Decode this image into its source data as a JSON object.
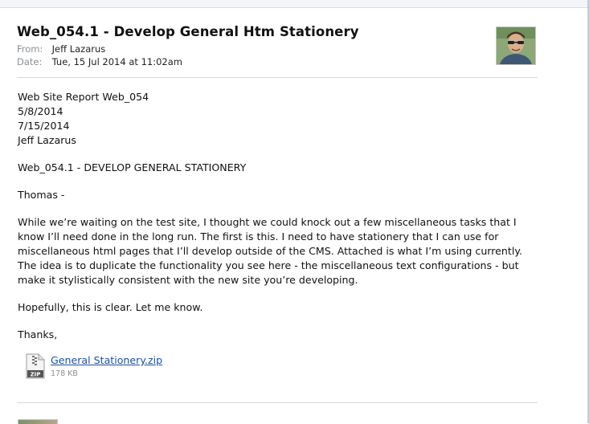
{
  "message": {
    "subject": "Web_054.1 - Develop General Htm Stationery",
    "from_label": "From:",
    "from_value": "Jeff Lazarus",
    "date_label": "Date:",
    "date_value": "Tue, 15 Jul 2014 at 11:02am"
  },
  "body": {
    "report_lines": [
      "Web Site Report Web_054",
      "5/8/2014",
      "7/15/2014",
      "Jeff Lazarus"
    ],
    "heading": "Web_054.1 - DEVELOP GENERAL STATIONERY",
    "salutation": "Thomas -",
    "paragraph_lines": [
      "While we’re waiting on the test site, I thought we could knock out a few miscellaneous tasks that I",
      "know I’ll need done in the long run. The first is this. I need to have stationery that I can use for",
      "miscellaneous html pages that I’ll develop outside of the CMS. Attached is what I’m using currently.",
      "The idea is to duplicate the functionality you see here - the miscellaneous text configurations - but",
      "make it stylistically consistent with the new site you’re developing."
    ],
    "closing_line": "Hopefully, this is clear. Let me know.",
    "signoff": "Thanks,"
  },
  "attachment": {
    "name": "General Stationery.zip",
    "size": "178 KB",
    "icon": "zip-file-icon",
    "icon_badge": "ZIP"
  }
}
